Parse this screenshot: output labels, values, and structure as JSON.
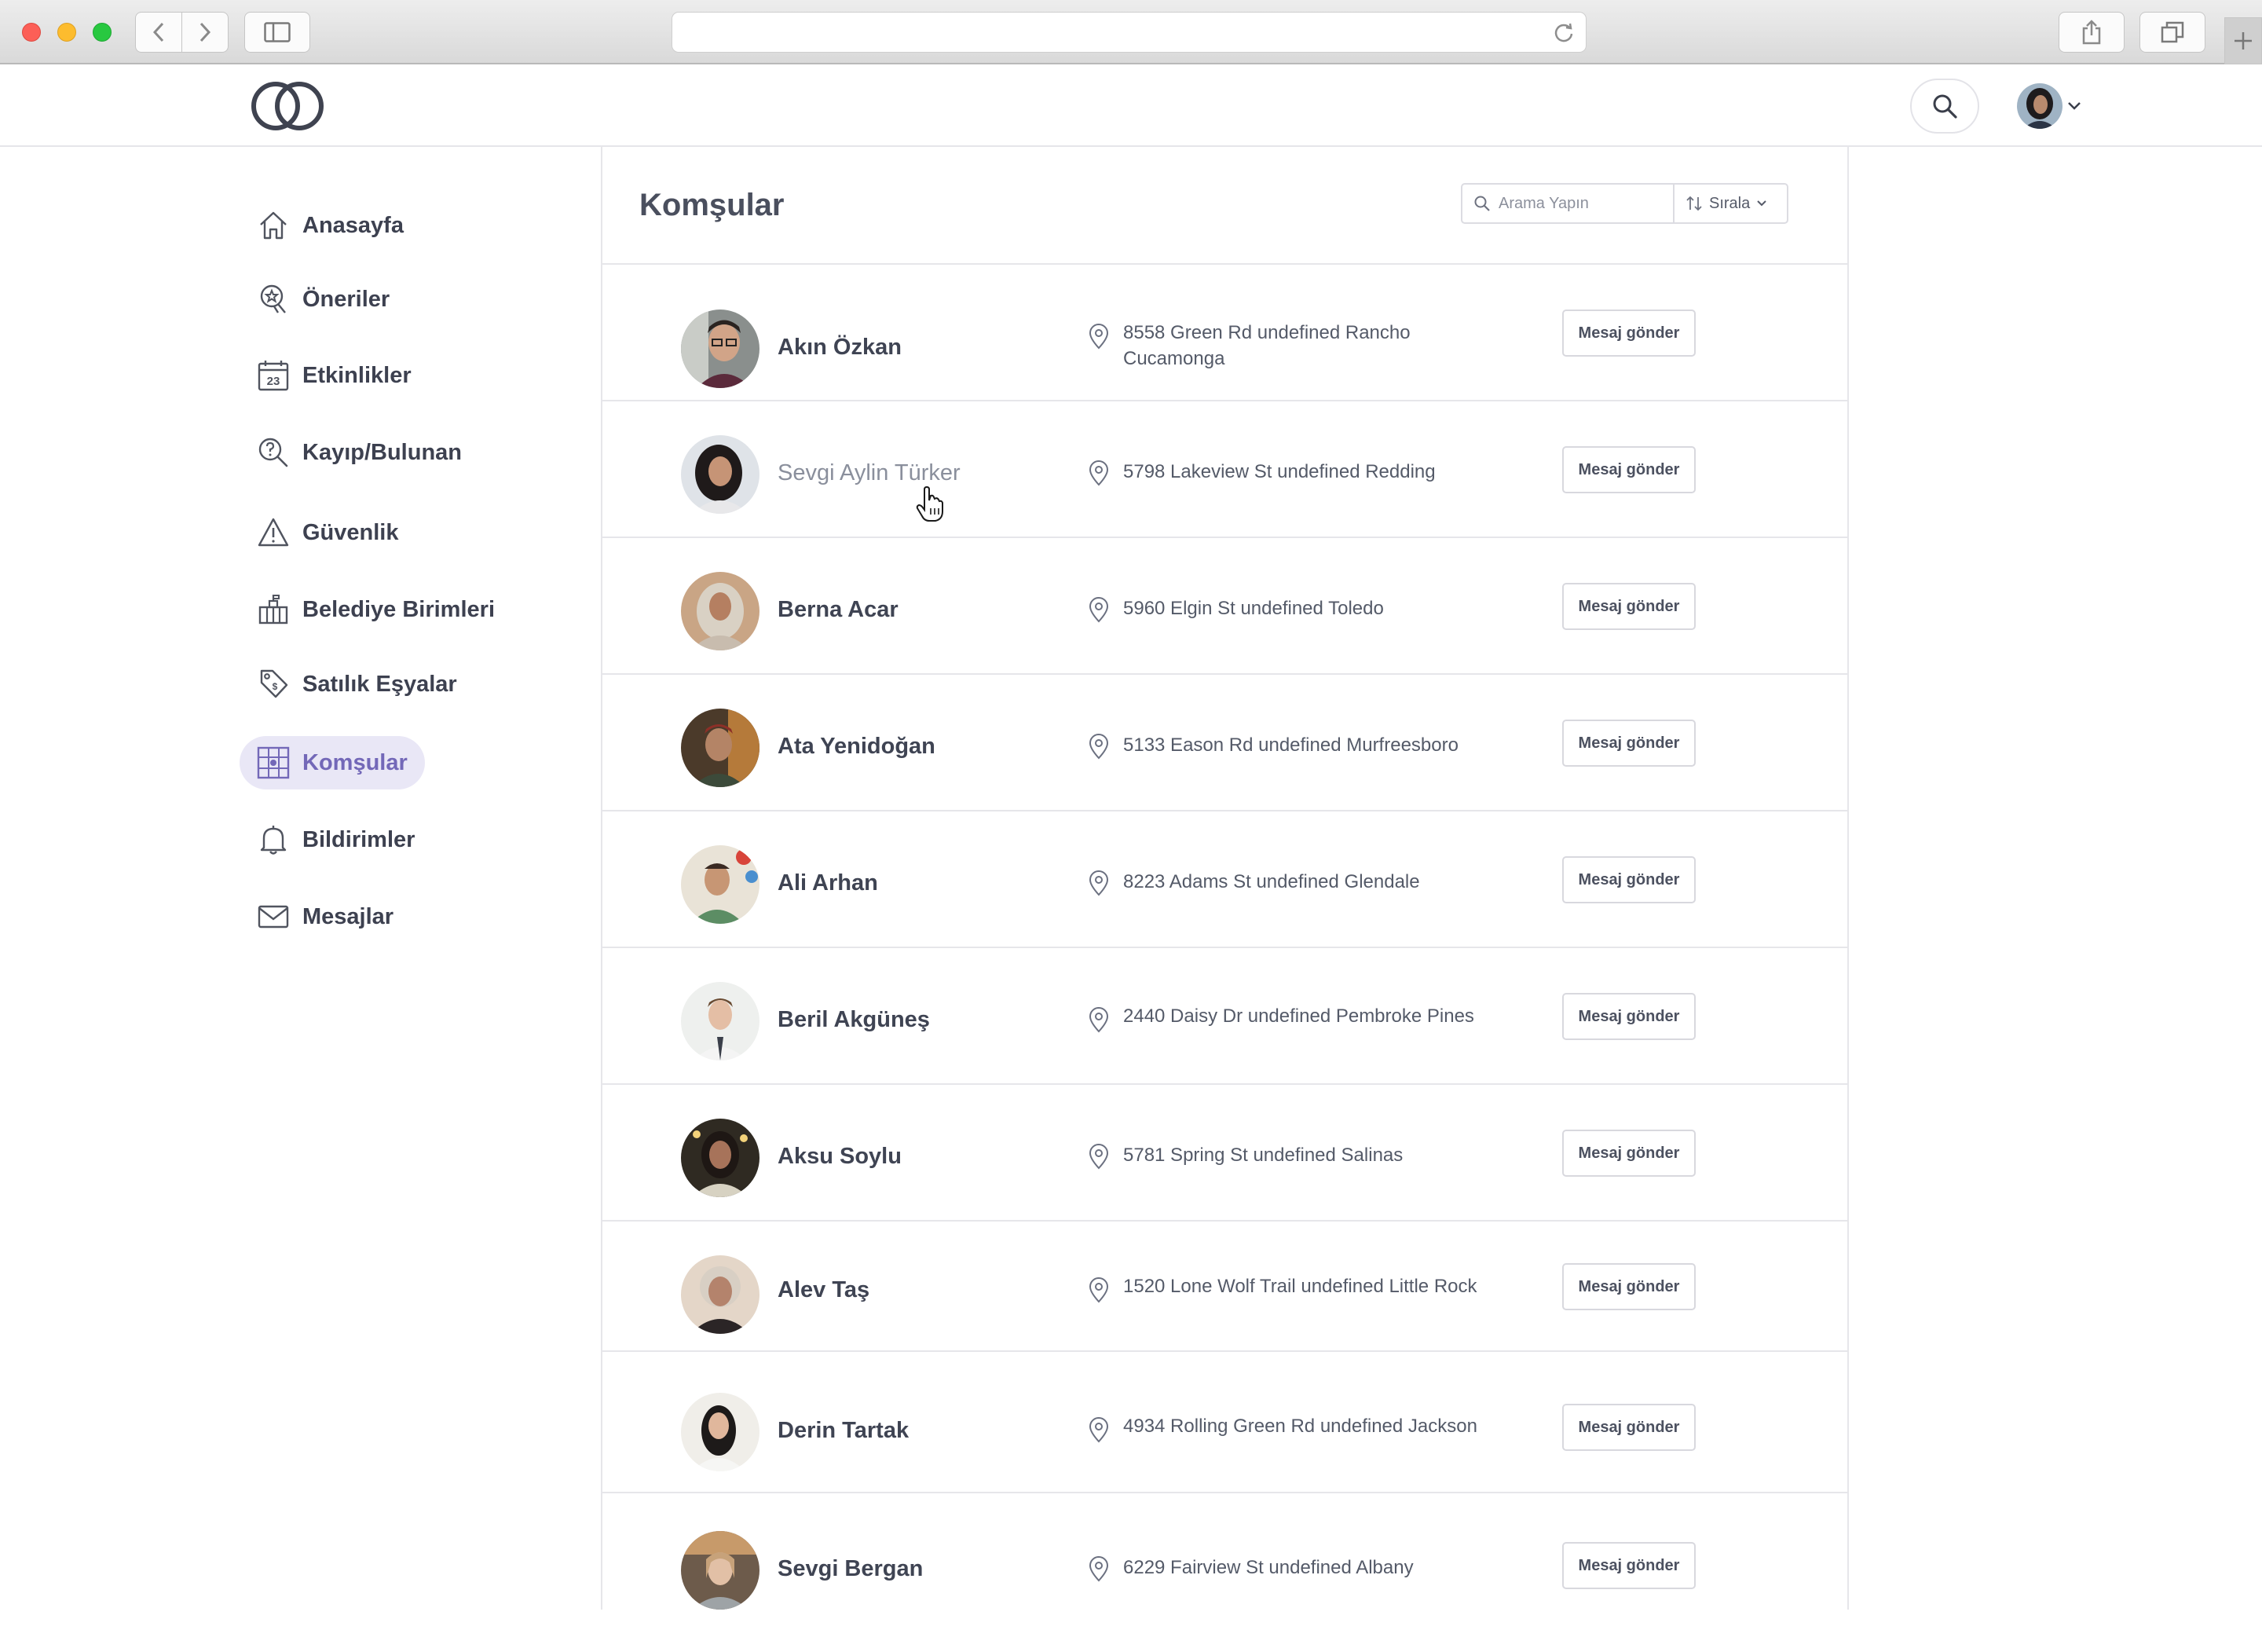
{
  "header": {
    "search_aria": "search"
  },
  "sidebar": {
    "items": [
      {
        "label": "Anasayfa",
        "icon": "home-icon",
        "active": false
      },
      {
        "label": "Öneriler",
        "icon": "star-badge-icon",
        "active": false
      },
      {
        "label": "Etkinlikler",
        "icon": "calendar-icon",
        "calendar_day": "23",
        "active": false
      },
      {
        "label": "Kayıp/Bulunan",
        "icon": "question-search-icon",
        "active": false
      },
      {
        "label": "Güvenlik",
        "icon": "warning-icon",
        "active": false
      },
      {
        "label": "Belediye Birimleri",
        "icon": "municipality-icon",
        "active": false
      },
      {
        "label": "Satılık Eşyalar",
        "icon": "tag-icon",
        "active": false
      },
      {
        "label": "Komşular",
        "icon": "neighbors-icon",
        "active": true
      },
      {
        "label": "Bildirimler",
        "icon": "bell-icon",
        "active": false
      },
      {
        "label": "Mesajlar",
        "icon": "mail-icon",
        "active": false
      }
    ]
  },
  "main": {
    "title": "Komşular",
    "search_placeholder": "Arama Yapın",
    "sort_label": "Sırala",
    "message_button_label": "Mesaj gönder"
  },
  "neighbors": [
    {
      "name": "Akın Özkan",
      "address": "8558 Green Rd undefined Rancho Cucamonga",
      "hovered": false
    },
    {
      "name": "Sevgi Aylin Türker",
      "address": "5798 Lakeview St undefined Redding",
      "hovered": true
    },
    {
      "name": "Berna Acar",
      "address": "5960 Elgin St undefined Toledo",
      "hovered": false
    },
    {
      "name": "Ata Yenidoğan",
      "address": "5133 Eason Rd undefined Murfreesboro",
      "hovered": false
    },
    {
      "name": "Ali Arhan",
      "address": "8223 Adams St undefined Glendale",
      "hovered": false
    },
    {
      "name": "Beril Akgüneş",
      "address": "2440 Daisy Dr undefined Pembroke Pines",
      "hovered": false
    },
    {
      "name": "Aksu Soylu",
      "address": "5781 Spring St undefined Salinas",
      "hovered": false
    },
    {
      "name": "Alev Taş",
      "address": "1520 Lone Wolf Trail undefined Little Rock",
      "hovered": false
    },
    {
      "name": "Derin Tartak",
      "address": "4934 Rolling Green Rd undefined Jackson",
      "hovered": false
    },
    {
      "name": "Sevgi Bergan",
      "address": "6229 Fairview St undefined Albany",
      "hovered": false
    }
  ],
  "colors": {
    "accent": "#7368b8",
    "active_bg": "#e9e7f6",
    "divider": "#e6e6ea"
  }
}
